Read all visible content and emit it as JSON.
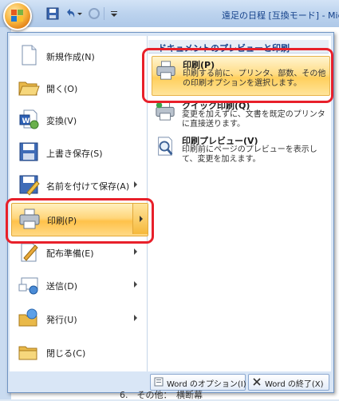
{
  "window": {
    "title": "遠足の日程 [互換モード] - Micr"
  },
  "menu_left": {
    "items": [
      {
        "label": "新規作成(N)",
        "icon": "new-document-icon",
        "has_arrow": false
      },
      {
        "label": "開く(O)",
        "icon": "open-folder-icon",
        "has_arrow": false
      },
      {
        "label": "変換(V)",
        "icon": "convert-icon",
        "has_arrow": false
      },
      {
        "label": "上書き保存(S)",
        "icon": "save-icon",
        "has_arrow": false
      },
      {
        "label": "名前を付けて保存(A)",
        "icon": "save-as-icon",
        "has_arrow": true
      },
      {
        "label": "印刷(P)",
        "icon": "printer-icon",
        "has_arrow": true,
        "active": true
      },
      {
        "label": "配布準備(E)",
        "icon": "prepare-icon",
        "has_arrow": true
      },
      {
        "label": "送信(D)",
        "icon": "send-icon",
        "has_arrow": true
      },
      {
        "label": "発行(U)",
        "icon": "publish-icon",
        "has_arrow": true
      },
      {
        "label": "閉じる(C)",
        "icon": "close-folder-icon",
        "has_arrow": false
      }
    ]
  },
  "menu_right": {
    "header": "ドキュメントのプレビューと印刷",
    "items": [
      {
        "title": "印刷(P)",
        "desc": "印刷する前に、プリンタ、部数、その他の印刷オプションを選択します。",
        "icon": "printer-icon",
        "active": true
      },
      {
        "title": "クイック印刷(Q)",
        "desc": "変更を加えずに、文書を既定のプリンタに直接送ります。",
        "icon": "quick-print-icon"
      },
      {
        "title": "印刷プレビュー(V)",
        "desc": "印刷前にページのプレビューを表示して、変更を加えます。",
        "icon": "print-preview-icon"
      }
    ]
  },
  "bottom": {
    "options_label": "Word のオプション(I)",
    "exit_label": "Word の終了(X)"
  },
  "doc_behind": {
    "bottom_line": "6.　その他：　横断幕"
  },
  "colors": {
    "highlight": "#ffd67a",
    "red_annotation": "#e8202a",
    "title_text": "#15428b"
  }
}
